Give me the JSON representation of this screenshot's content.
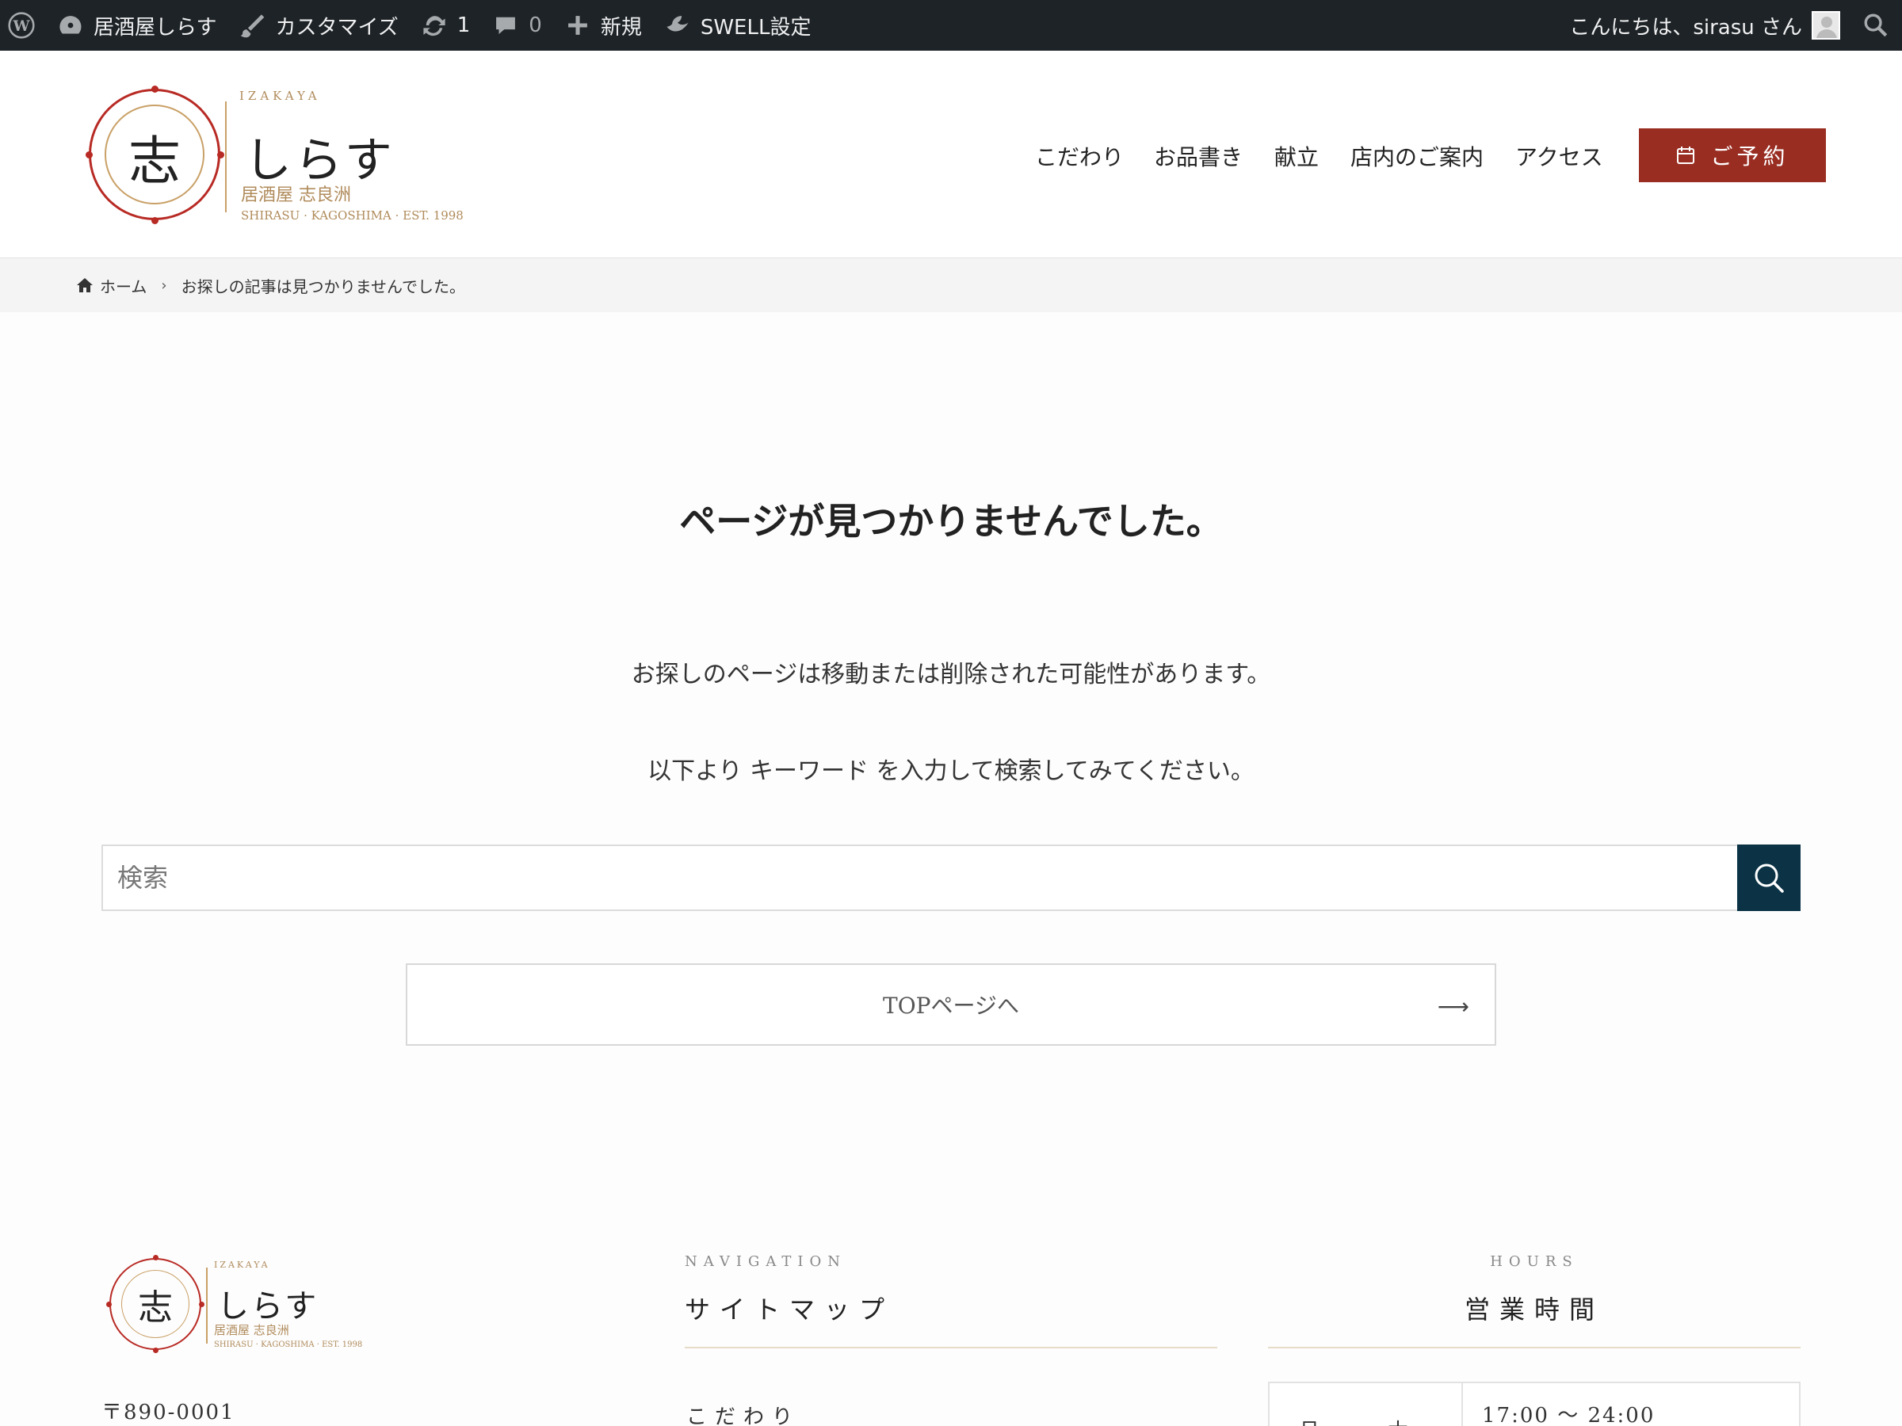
{
  "adminbar": {
    "site_name": "居酒屋しらす",
    "customize": "カスタマイズ",
    "updates_count": "1",
    "comments_count": "0",
    "new_label": "新規",
    "swell_label": "SWELL設定",
    "greeting": "こんにちは、sirasu さん"
  },
  "header": {
    "logo": {
      "kanji": "志",
      "izakaya": "IZAKAYA",
      "name": "しらす",
      "subtitle": "居酒屋 志良洲",
      "meta": "SHIRASU · KAGOSHIMA · EST. 1998"
    },
    "nav": [
      "こだわり",
      "お品書き",
      "献立",
      "店内のご案内",
      "アクセス"
    ],
    "reserve_label": "ご予約"
  },
  "breadcrumb": {
    "home": "ホーム",
    "current": "お探しの記事は見つかりませんでした。"
  },
  "main": {
    "title": "ページが見つかりませんでした。",
    "message1": "お探しのページは移動または削除された可能性があります。",
    "message2": "以下より キーワード を入力して検索してみてください。",
    "search_placeholder": "検索",
    "top_button": "TOPページへ",
    "top_arrow": "⟶"
  },
  "footer": {
    "logo": {
      "kanji": "志",
      "izakaya": "IZAKAYA",
      "name": "しらす",
      "subtitle": "居酒屋 志良洲",
      "meta": "SHIRASU · KAGOSHIMA · EST. 1998"
    },
    "postal": "〒890-0001",
    "nav_eyebrow": "NAVIGATION",
    "nav_heading": "サイトマップ",
    "nav_first_link": "こだわり",
    "hours_eyebrow": "HOURS",
    "hours_heading": "営業時間",
    "hours_day": "月〜木",
    "hours_time": "17:00 〜 24:00"
  },
  "colors": {
    "adminbar": "#1d2327",
    "brand_red": "#992d22",
    "gold": "#c9a066",
    "search_button": "#0b3345"
  }
}
